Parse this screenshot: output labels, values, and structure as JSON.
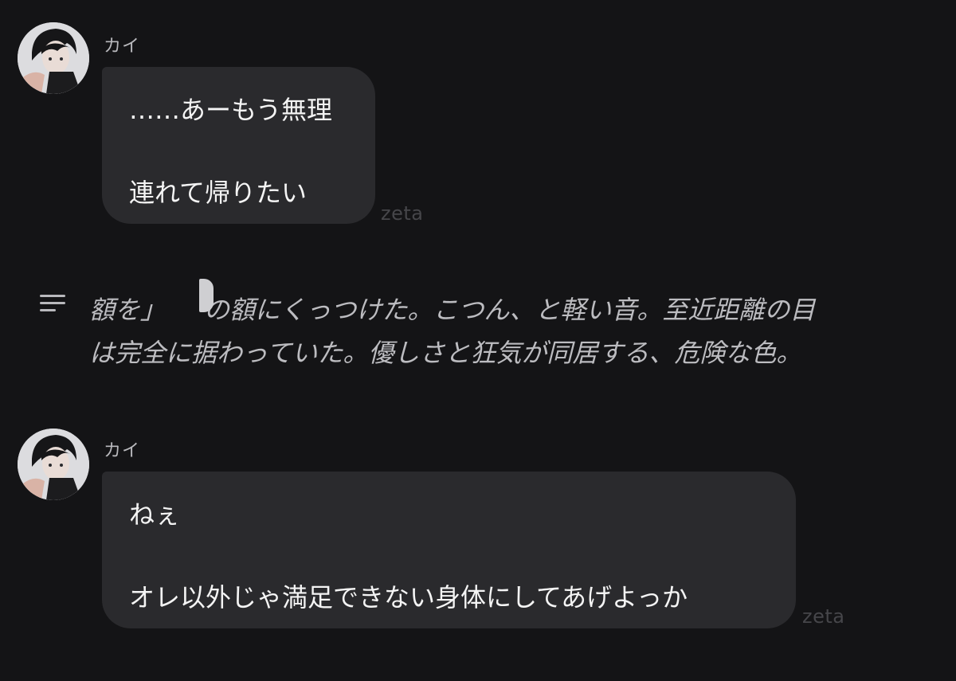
{
  "messages": [
    {
      "sender": "カイ",
      "avatar": "character-avatar",
      "lines": [
        "……あーもう無理",
        "",
        "連れて帰りたい"
      ],
      "watermark": "zeta"
    },
    {
      "sender": "カイ",
      "avatar": "character-avatar",
      "lines": [
        "ねぇ",
        "",
        "オレ以外じゃ満足できない身体にしてあげよっか"
      ],
      "watermark": "zeta"
    }
  ],
  "narration": {
    "icon": "text-lines-icon",
    "lines": [
      "額を」　　の額にくっつけた。こつん、と軽い音。至近距離の目",
      "は完全に据わっていた。優しさと狂気が同居する、危険な色。"
    ]
  },
  "colors": {
    "background": "#141416",
    "bubble": "#2a2a2d",
    "text": "#f4f4f4",
    "muted_text": "#bcbcc0",
    "watermark": "#46464a"
  }
}
